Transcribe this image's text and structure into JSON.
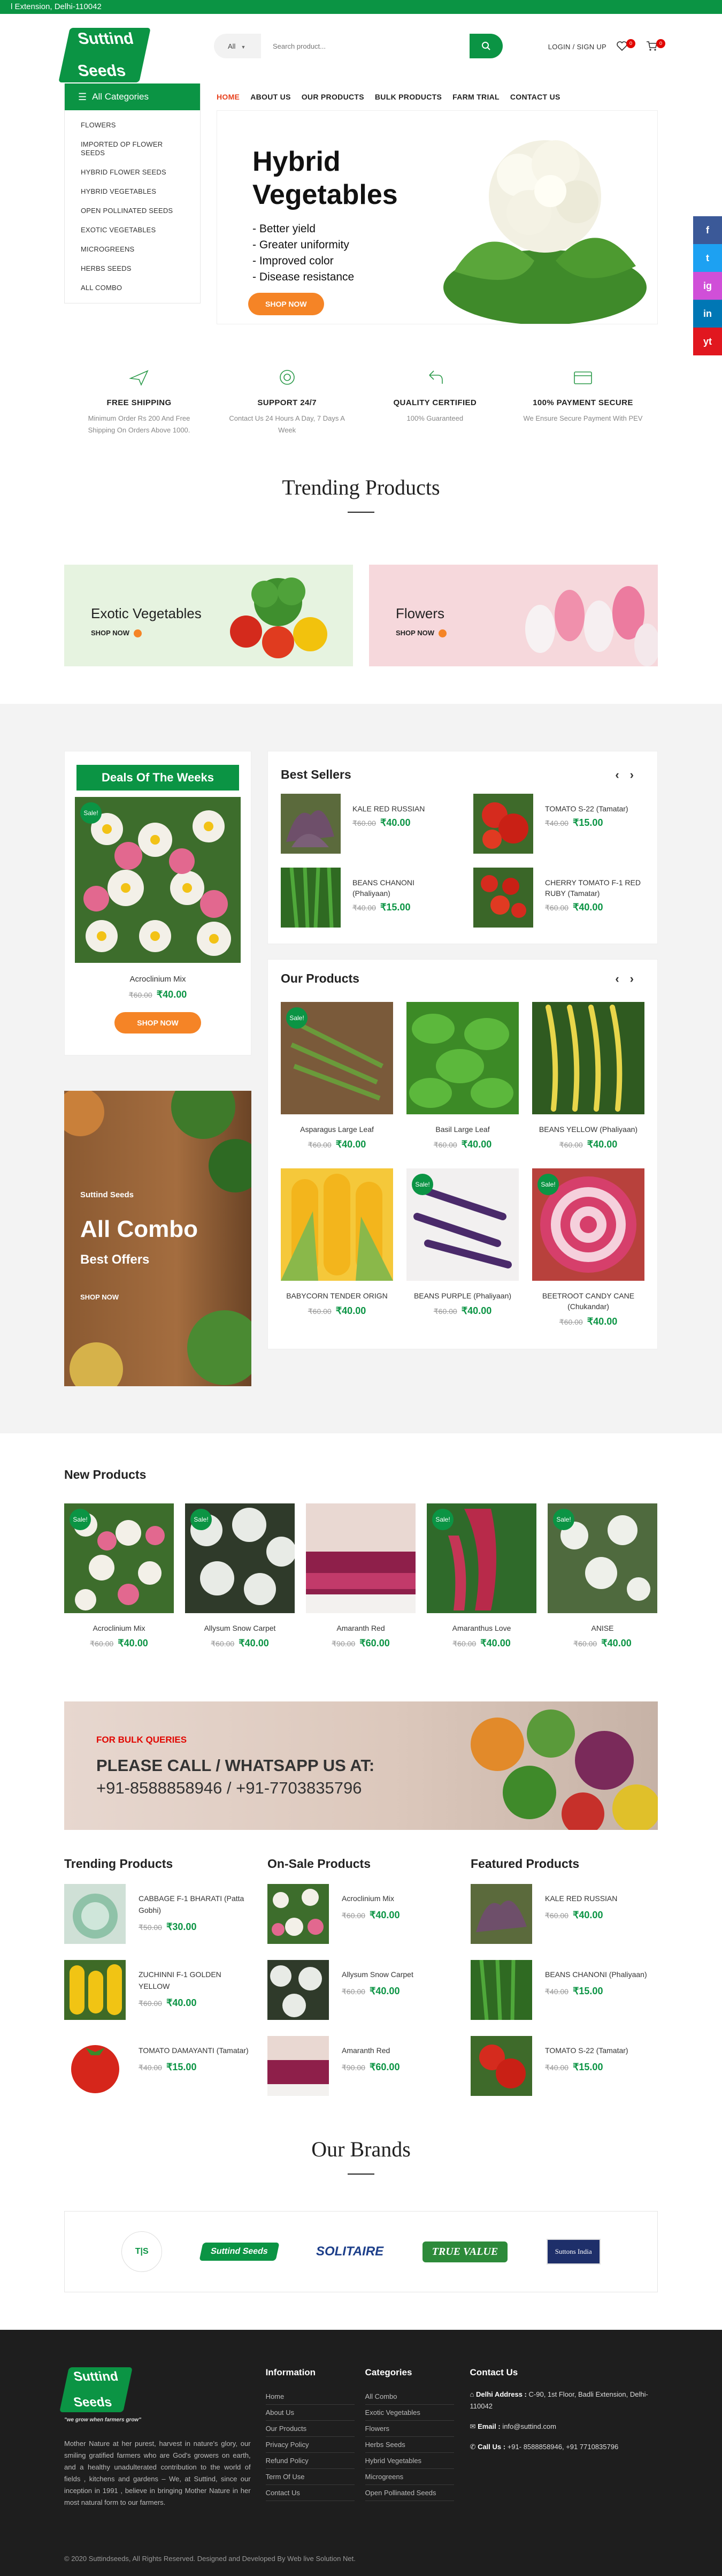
{
  "topbar": {
    "address": "l Extension, Delhi-110042"
  },
  "brand": {
    "name_line1": "Suttind",
    "name_line2": "Seeds",
    "tagline": "\"we grow when farmers grow\"",
    "color": "#0b9444"
  },
  "search": {
    "category": "All",
    "placeholder": "Search product..."
  },
  "header": {
    "login": "LOGIN / SIGN UP",
    "wishlist_count": "0",
    "cart_count": "0"
  },
  "categories": {
    "title": "All Categories",
    "items": [
      "FLOWERS",
      "IMPORTED OP FLOWER SEEDS",
      "HYBRID FLOWER SEEDS",
      "HYBRID VEGETABLES",
      "OPEN POLLINATED SEEDS",
      "EXOTIC VEGETABLES",
      "MICROGREENS",
      "HERBS SEEDS",
      "ALL COMBO"
    ]
  },
  "nav": [
    "HOME",
    "ABOUT US",
    "OUR PRODUCTS",
    "BULK PRODUCTS",
    "FARM TRIAL",
    "CONTACT US"
  ],
  "hero": {
    "title_line1": "Hybrid",
    "title_line2": "Vegetables",
    "bullets": [
      "Better yield",
      "Greater uniformity",
      "Improved color",
      "Disease resistance"
    ],
    "button": "SHOP NOW"
  },
  "social": [
    "f",
    "t",
    "ig",
    "in",
    "yt"
  ],
  "features": [
    {
      "title": "FREE SHIPPING",
      "desc": "Minimum Order Rs 200 And Free Shipping On Orders Above 1000."
    },
    {
      "title": "SUPPORT 24/7",
      "desc": "Contact Us 24 Hours A Day, 7 Days A Week"
    },
    {
      "title": "QUALITY CERTIFIED",
      "desc": "100% Guaranteed"
    },
    {
      "title": "100% PAYMENT SECURE",
      "desc": "We Ensure Secure Payment With PEV"
    }
  ],
  "trending_title": "Trending Products",
  "banners": [
    {
      "title": "Exotic Vegetables",
      "cta": "SHOP NOW"
    },
    {
      "title": "Flowers",
      "cta": "SHOP NOW"
    }
  ],
  "deal": {
    "title": "Deals Of The Weeks",
    "sale": "Sale!",
    "name": "Acroclinium Mix",
    "old": "₹60.00",
    "new": "₹40.00",
    "button": "SHOP NOW"
  },
  "combo": {
    "logo": "Suttind Seeds",
    "title": "All Combo",
    "sub": "Best Offers",
    "cta": "SHOP NOW"
  },
  "best_sellers": {
    "title": "Best Sellers",
    "items": [
      {
        "name": "KALE RED RUSSIAN",
        "old": "₹60.00",
        "new": "₹40.00"
      },
      {
        "name": "TOMATO S-22 (Tamatar)",
        "old": "₹40.00",
        "new": "₹15.00"
      },
      {
        "name": "BEANS CHANONI (Phaliyaan)",
        "old": "₹40.00",
        "new": "₹15.00"
      },
      {
        "name": "CHERRY TOMATO F-1 RED RUBY (Tamatar)",
        "old": "₹60.00",
        "new": "₹40.00"
      }
    ]
  },
  "our_products": {
    "title": "Our Products",
    "items": [
      {
        "name": "Asparagus Large Leaf",
        "old": "₹60.00",
        "new": "₹40.00",
        "sale": "Sale!"
      },
      {
        "name": "Basil Large Leaf",
        "old": "₹60.00",
        "new": "₹40.00",
        "sale": ""
      },
      {
        "name": "BEANS YELLOW (Phaliyaan)",
        "old": "₹60.00",
        "new": "₹40.00",
        "sale": ""
      },
      {
        "name": "BABYCORN TENDER ORIGN",
        "old": "₹60.00",
        "new": "₹40.00",
        "sale": ""
      },
      {
        "name": "BEANS PURPLE (Phaliyaan)",
        "old": "₹60.00",
        "new": "₹40.00",
        "sale": "Sale!"
      },
      {
        "name": "BEETROOT CANDY CANE (Chukandar)",
        "old": "₹60.00",
        "new": "₹40.00",
        "sale": "Sale!"
      }
    ]
  },
  "new_products": {
    "title": "New Products",
    "items": [
      {
        "name": "Acroclinium Mix",
        "old": "₹60.00",
        "new": "₹40.00",
        "sale": "Sale!"
      },
      {
        "name": "Allysum Snow Carpet",
        "old": "₹60.00",
        "new": "₹40.00",
        "sale": "Sale!"
      },
      {
        "name": "Amaranth Red",
        "old": "₹90.00",
        "new": "₹60.00",
        "sale": ""
      },
      {
        "name": "Amaranthus Love",
        "old": "₹60.00",
        "new": "₹40.00",
        "sale": "Sale!"
      },
      {
        "name": "ANISE",
        "old": "₹60.00",
        "new": "₹40.00",
        "sale": "Sale!"
      }
    ]
  },
  "bulk": {
    "queries": "FOR BULK QUERIES",
    "title": "PLEASE CALL / WHATSAPP US AT:",
    "phones": "+91-8588858946 / +91-7703835796"
  },
  "lists": [
    {
      "title": "Trending Products",
      "items": [
        {
          "name": "CABBAGE F-1 BHARATI (Patta Gobhi)",
          "old": "₹50.00",
          "new": "₹30.00"
        },
        {
          "name": "ZUCHINNI F-1 GOLDEN YELLOW",
          "old": "₹60.00",
          "new": "₹40.00"
        },
        {
          "name": "TOMATO DAMAYANTI (Tamatar)",
          "old": "₹40.00",
          "new": "₹15.00"
        }
      ]
    },
    {
      "title": "On-Sale Products",
      "items": [
        {
          "name": "Acroclinium Mix",
          "old": "₹60.00",
          "new": "₹40.00"
        },
        {
          "name": "Allysum Snow Carpet",
          "old": "₹60.00",
          "new": "₹40.00"
        },
        {
          "name": "Amaranth Red",
          "old": "₹90.00",
          "new": "₹60.00"
        }
      ]
    },
    {
      "title": "Featured Products",
      "items": [
        {
          "name": "KALE RED RUSSIAN",
          "old": "₹60.00",
          "new": "₹40.00"
        },
        {
          "name": "BEANS CHANONI (Phaliyaan)",
          "old": "₹40.00",
          "new": "₹15.00"
        },
        {
          "name": "TOMATO S-22 (Tamatar)",
          "old": "₹40.00",
          "new": "₹15.00"
        }
      ]
    }
  ],
  "brands_title": "Our Brands",
  "brands": [
    "T|S",
    "Suttind Seeds",
    "SOLITAIRE",
    "TRUE VALUE",
    "Suttons India"
  ],
  "footer": {
    "about": "Mother Nature at her purest, harvest in nature's glory, our smiling gratified farmers who are God's growers on earth, and a healthy unadulterated contribution to the world of fields , kitchens and gardens – We, at Suttind, since our inception in 1991 , believe in bringing Mother Nature in her most natural form to our farmers.",
    "info_title": "Information",
    "info": [
      "Home",
      "About Us",
      "Our Products",
      "Privacy Policy",
      "Refund Policy",
      "Term Of Use",
      "Contact Us"
    ],
    "cat_title": "Categories",
    "cats": [
      "All Combo",
      "Exotic Vegetables",
      "Flowers",
      "Herbs Seeds",
      "Hybrid Vegetables",
      "Microgreens",
      "Open Pollinated Seeds"
    ],
    "contact_title": "Contact Us",
    "addr_label": "Delhi Address :",
    "addr": "C-90, 1st Floor, Badli Extension, Delhi-110042",
    "email_label": "Email :",
    "email": "info@suttind.com",
    "call_label": "Call Us :",
    "call": "+91- 8588858946, +91 7710835796",
    "copyright": "© 2020 Suttindseeds, All Rights Reserved. Designed and Developed By Web live Solution Net."
  }
}
